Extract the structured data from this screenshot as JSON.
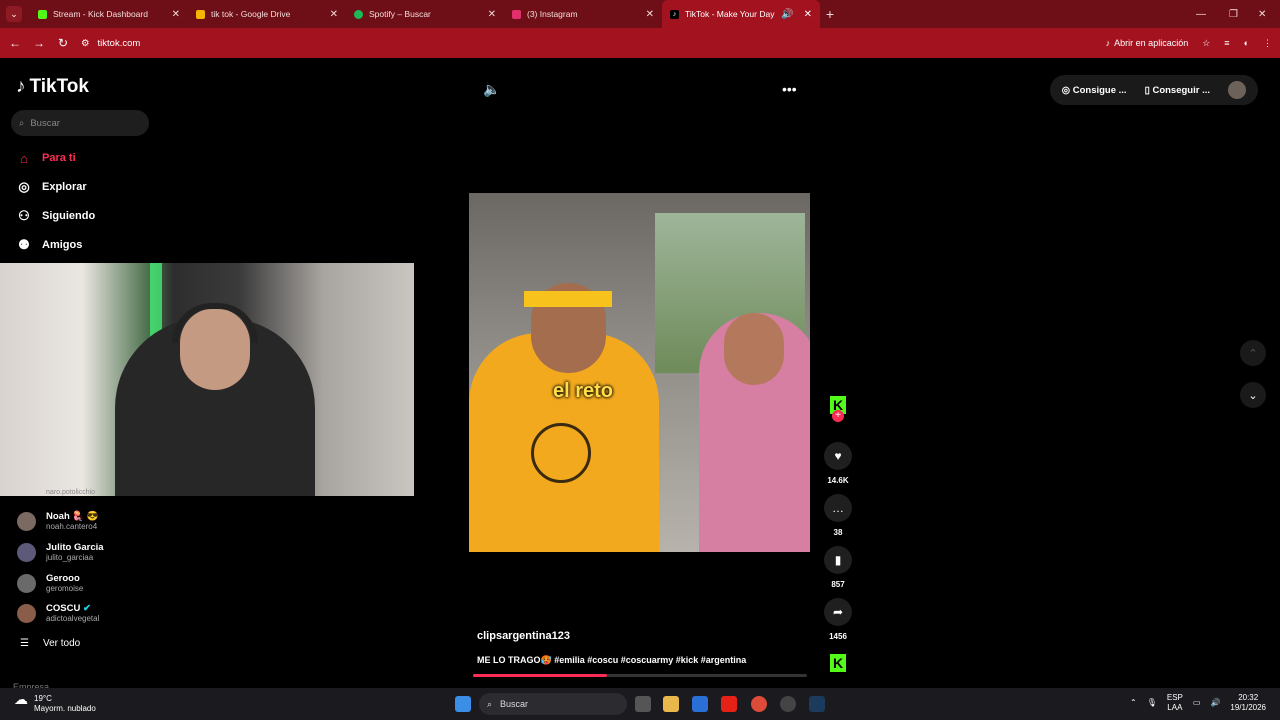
{
  "browser": {
    "tabs": [
      {
        "title": "Stream - Kick Dashboard",
        "color": "#53fc18"
      },
      {
        "title": "tik tok - Google Drive",
        "color": "#f4b400"
      },
      {
        "title": "Spotify – Buscar",
        "color": "#1db954"
      },
      {
        "title": "(3) Instagram",
        "color": "#e1306c"
      },
      {
        "title": "TikTok - Make Your Day",
        "color": "#000000"
      }
    ],
    "url": "tiktok.com",
    "open_in_app": "Abrir en aplicación"
  },
  "tiktok": {
    "logo": "TikTok",
    "search_placeholder": "Buscar",
    "nav": [
      {
        "label": "Para ti",
        "icon": "home-icon"
      },
      {
        "label": "Explorar",
        "icon": "compass-icon"
      },
      {
        "label": "Siguiendo",
        "icon": "following-icon"
      },
      {
        "label": "Amigos",
        "icon": "friends-icon"
      }
    ],
    "partial_handle": "naro.potolicchio",
    "following_accounts": [
      {
        "name": "Noah 🪼 😎",
        "handle": "noah.cantero4"
      },
      {
        "name": "Julito Garcia",
        "handle": "julito_garciaa"
      },
      {
        "name": "Gerooo",
        "handle": "geromoise"
      },
      {
        "name": "COSCU",
        "handle": "adictoalvegetal"
      }
    ],
    "see_all": "Ver todo",
    "company": "Empresa",
    "top_pill": {
      "coins": "Consigue ...",
      "app": "Conseguir ..."
    },
    "video": {
      "caption_overlay": "el reto",
      "author": "clipsargentina123",
      "description": "ME LO TRAGO🥵 #emilia #coscu #coscuarmy #kick #argentina",
      "progress": 0.4
    },
    "actions": {
      "likes": "14.6K",
      "comments": "38",
      "saves": "857",
      "shares": "1456"
    }
  },
  "taskbar": {
    "temperature": "19°C",
    "weather": "Mayorm. nublado",
    "search": "Buscar",
    "lang": "ESP",
    "lang_sub": "LAA",
    "time": "20:32",
    "date": "19/1/2026"
  }
}
